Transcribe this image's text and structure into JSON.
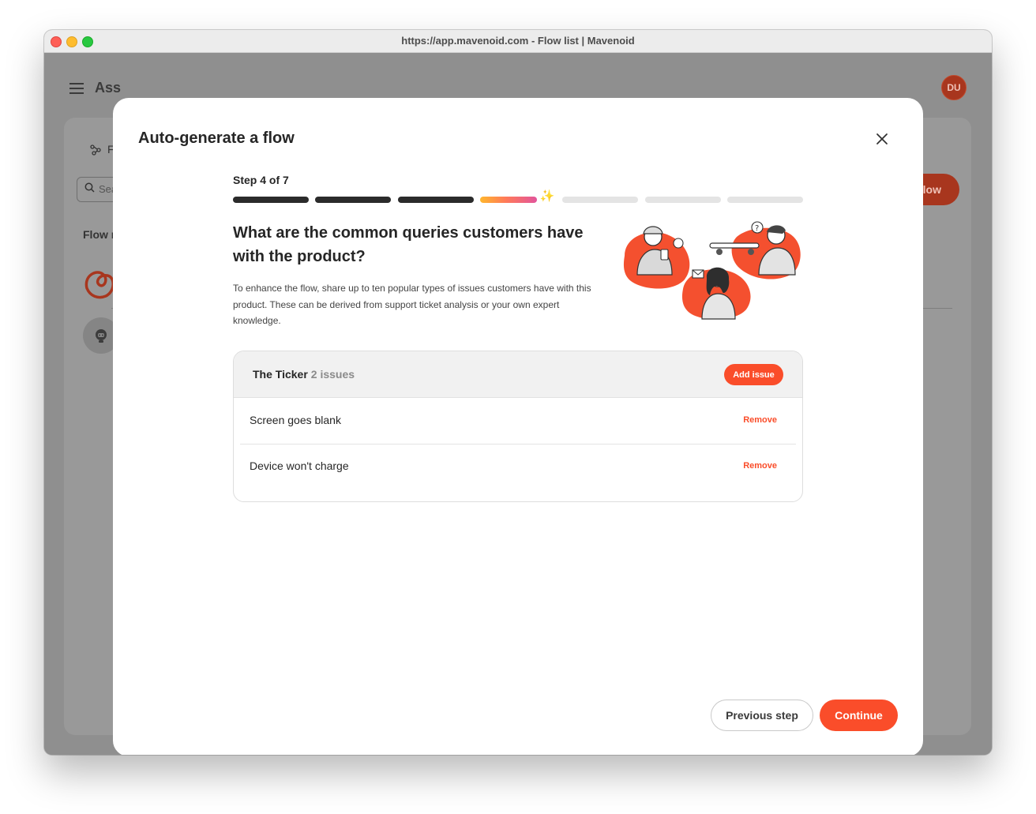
{
  "window": {
    "title": "https://app.mavenoid.com - Flow list | Mavenoid"
  },
  "background_app": {
    "title": "Ass",
    "avatar_initials": "DU",
    "tab_flows": "F",
    "search_placeholder": "Sea",
    "new_flow_button": "flow",
    "list_header": "Flow r"
  },
  "modal": {
    "title": "Auto-generate a flow",
    "step_label": "Step 4 of 7",
    "steps": {
      "current": 4,
      "total": 7
    },
    "question": "What are the common queries customers have with the product?",
    "description": "To enhance the flow, share up to ten popular types of issues customers have with this product. These can be derived from support ticket analysis or your own expert knowledge.",
    "card": {
      "product_name": "The Ticker",
      "issue_count": "2 issues",
      "add_issue_label": "Add issue",
      "issues": [
        {
          "text": "Screen goes blank",
          "remove_label": "Remove"
        },
        {
          "text": "Device won't charge",
          "remove_label": "Remove"
        }
      ]
    },
    "previous_label": "Previous step",
    "continue_label": "Continue"
  },
  "colors": {
    "accent": "#fa4d2a",
    "dark": "#262626",
    "progress_done": "#2b2b2b",
    "progress_todo": "#e4e4e4"
  },
  "icons": {
    "close": "close-icon",
    "sparkle": "sparkle-icon",
    "menu": "hamburger-icon",
    "search": "search-icon"
  }
}
